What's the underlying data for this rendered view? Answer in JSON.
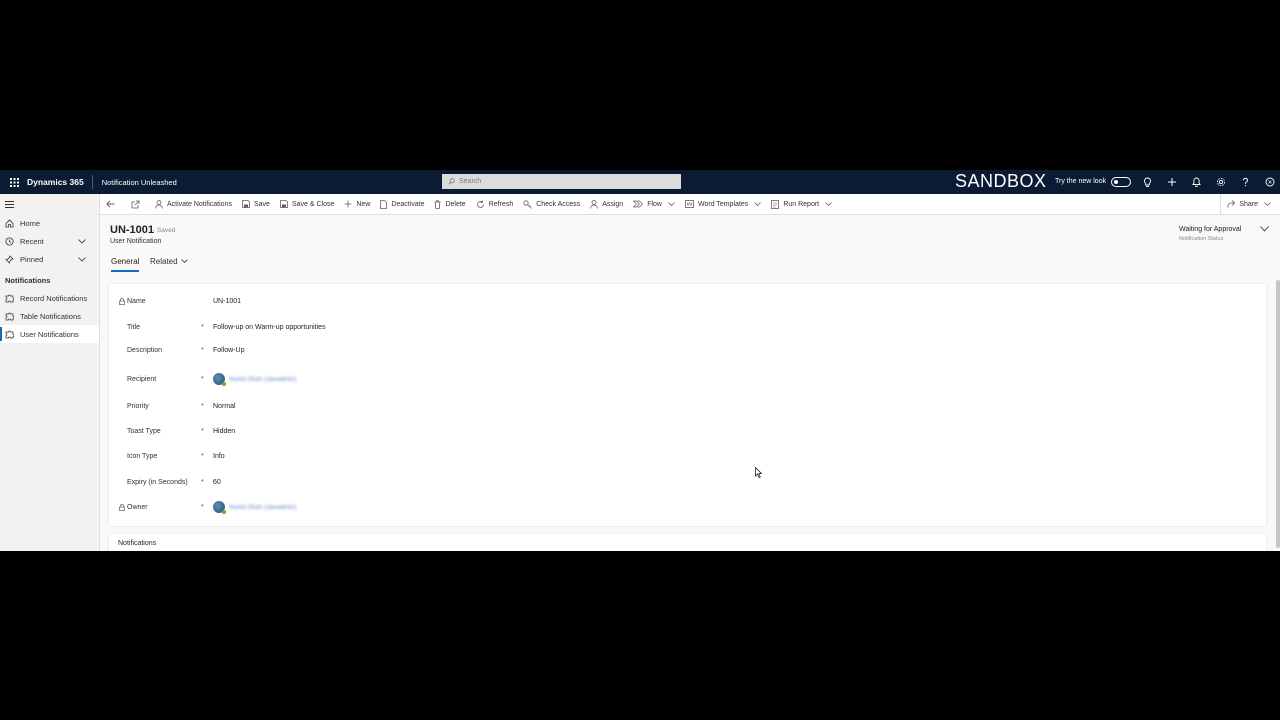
{
  "topbar": {
    "brand": "Dynamics 365",
    "app_name": "Notification Unleashed",
    "search_placeholder": "Search",
    "environment": "SANDBOX",
    "new_look_label": "Try the new look"
  },
  "commands": {
    "activate": "Activate Notifications",
    "save": "Save",
    "save_close": "Save & Close",
    "new": "New",
    "deactivate": "Deactivate",
    "delete": "Delete",
    "refresh": "Refresh",
    "check_access": "Check Access",
    "assign": "Assign",
    "flow": "Flow",
    "word_templates": "Word Templates",
    "run_report": "Run Report",
    "share": "Share"
  },
  "nav": {
    "home": "Home",
    "recent": "Recent",
    "pinned": "Pinned",
    "group": "Notifications",
    "items": [
      "Record Notifications",
      "Table Notifications",
      "User Notifications"
    ]
  },
  "record": {
    "title": "UN-1001",
    "saved": "- Saved",
    "entity": "User Notification",
    "status_value": "Waiting for Approval",
    "status_label": "Notification Status"
  },
  "tabs": {
    "general": "General",
    "related": "Related"
  },
  "fields": [
    {
      "label": "Name",
      "value": "UN-1001",
      "locked": true,
      "required": false
    },
    {
      "label": "Title",
      "value": "Follow-up on Warm-up opportunities",
      "locked": false,
      "required": true
    },
    {
      "label": "Description",
      "value": "Follow-Up",
      "locked": false,
      "required": true
    },
    {
      "label": "Recipient",
      "value": "Romil Shah (sbxadmin)",
      "locked": false,
      "required": true
    },
    {
      "label": "Priority",
      "value": "Normal",
      "locked": false,
      "required": true
    },
    {
      "label": "Toast Type",
      "value": "Hidden",
      "locked": false,
      "required": true
    },
    {
      "label": "Icon Type",
      "value": "Info",
      "locked": false,
      "required": true
    },
    {
      "label": "Expiry (in Seconds)",
      "value": "60",
      "locked": false,
      "required": true
    },
    {
      "label": "Owner",
      "value": "Romil Shah (sbxadmin)",
      "locked": true,
      "required": true
    }
  ],
  "section2": {
    "label": "Notifications"
  }
}
